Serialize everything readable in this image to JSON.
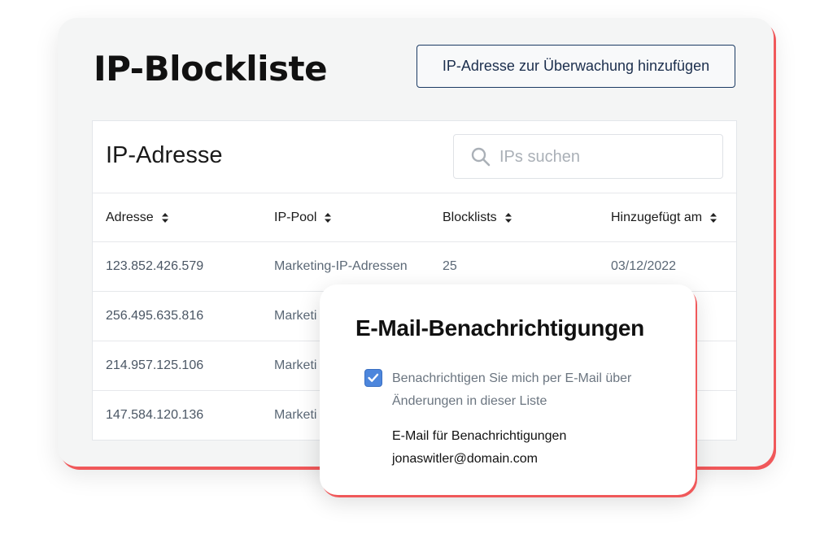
{
  "page": {
    "title": "IP-Blockliste",
    "add_button_label": "IP-Adresse zur Überwachung hinzufügen"
  },
  "table": {
    "title": "IP-Adresse",
    "search_placeholder": "IPs suchen",
    "search_value": "",
    "columns": [
      "Adresse",
      "IP-Pool",
      "Blocklists",
      "Hinzugefügt am"
    ],
    "rows": [
      {
        "address": "123.852.426.579",
        "pool": "Marketing-IP-Adressen",
        "blocklists": "25",
        "added": "03/12/2022"
      },
      {
        "address": "256.495.635.816",
        "pool": "Marketi",
        "blocklists": "",
        "added": ""
      },
      {
        "address": "214.957.125.106",
        "pool": "Marketi",
        "blocklists": "",
        "added": ""
      },
      {
        "address": "147.584.120.136",
        "pool": "Marketi",
        "blocklists": "",
        "added": ""
      }
    ]
  },
  "popup": {
    "title": "E-Mail-Benachrichtigungen",
    "checkbox_checked": true,
    "checkbox_label": "Benachrichtigen Sie mich per E-Mail über Änderungen in dieser Liste",
    "email_label": "E-Mail für Benachrichtigungen",
    "email_value": "jonaswitler@domain.com"
  },
  "colors": {
    "accent_red": "#f0585a",
    "checkbox_blue": "#4d86dc",
    "button_border": "#1b3a63"
  },
  "icons": {
    "search": "search-icon",
    "sort": "sort-arrows-icon",
    "check": "checkmark-icon"
  }
}
